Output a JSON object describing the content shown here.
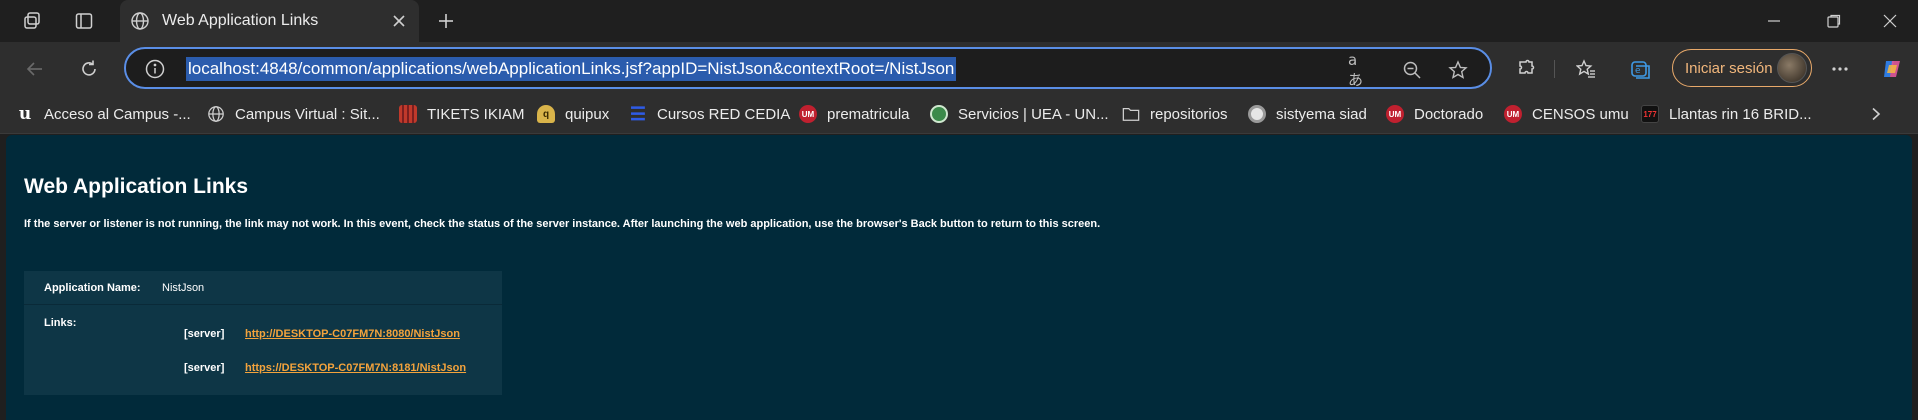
{
  "browser": {
    "tab": {
      "title": "Web Application Links"
    },
    "address_bar": {
      "url": "localhost:4848/common/applications/webApplicationLinks.jsf?appID=NistJson&contextRoot=/NistJson"
    },
    "signin_label": "Iniciar sesión",
    "accent_color": "#5a8ee6",
    "signin_color": "#f2b77c"
  },
  "bookmarks": [
    {
      "label": "Acceso al Campus -...",
      "icon": "u-logo-icon"
    },
    {
      "label": "Campus Virtual : Sit...",
      "icon": "globe-icon"
    },
    {
      "label": "TIKETS IKIAM",
      "icon": "ikiam-icon"
    },
    {
      "label": "quipux",
      "icon": "quipux-icon"
    },
    {
      "label": "Cursos RED CEDIA",
      "icon": "cedia-icon"
    },
    {
      "label": "prematricula",
      "icon": "um-icon"
    },
    {
      "label": "Servicios | UEA - UN...",
      "icon": "uea-icon"
    },
    {
      "label": "repositorios",
      "icon": "folder-icon"
    },
    {
      "label": "sistyema siad",
      "icon": "siad-icon"
    },
    {
      "label": "Doctorado",
      "icon": "um-icon"
    },
    {
      "label": "CENSOS umu",
      "icon": "um-icon"
    },
    {
      "label": "Llantas rin 16 BRID...",
      "icon": "llantas-icon"
    }
  ],
  "page": {
    "title": "Web Application Links",
    "help_text": "If the server or listener is not running, the link may not work. In this event, check the status of the server instance. After launching the web application, use the browser's Back button to return to this screen.",
    "application_name_label": "Application Name:",
    "application_name": "NistJson",
    "links_label": "Links:",
    "links": [
      {
        "server": "[server]",
        "url": "http://DESKTOP-C07FM7N:8080/NistJson"
      },
      {
        "server": "[server]",
        "url": "https://DESKTOP-C07FM7N:8181/NistJson"
      }
    ],
    "background_color": "#012a3a",
    "link_color": "#f3a33c"
  }
}
